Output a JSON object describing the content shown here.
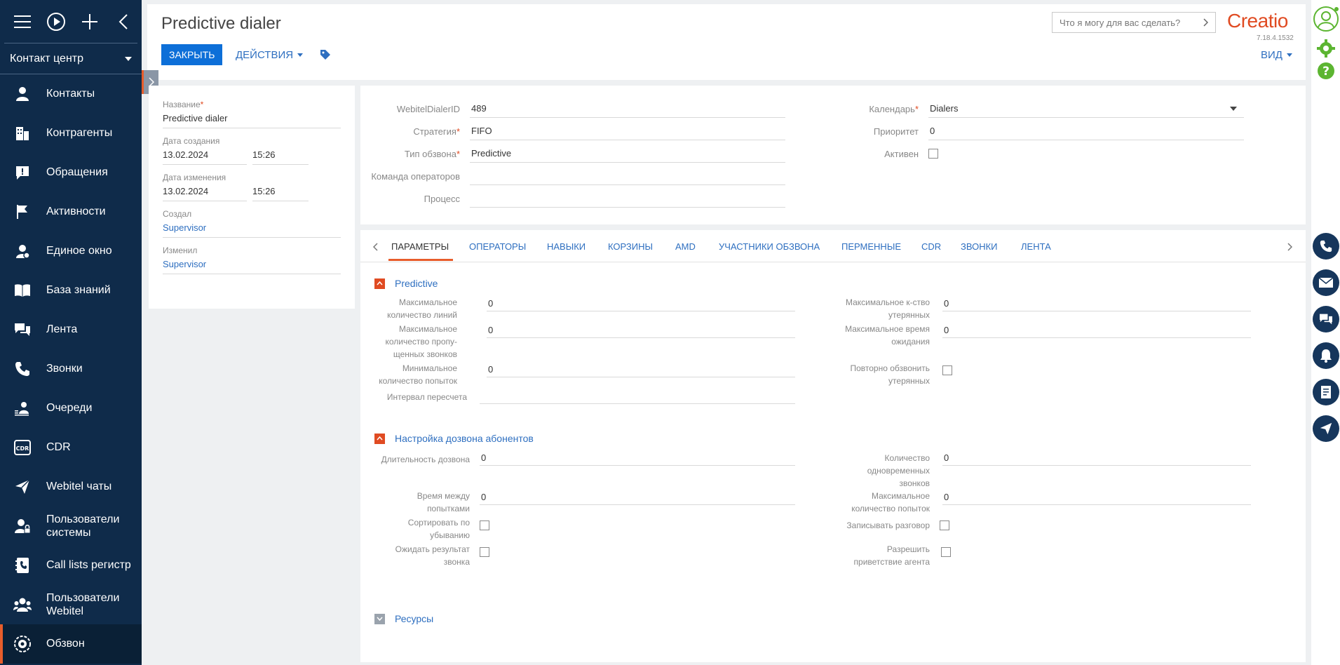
{
  "sidebar": {
    "section": "Контакт центр",
    "items": [
      {
        "label": "Контакты",
        "icon": "person-icon"
      },
      {
        "label": "Контрагенты",
        "icon": "building-icon"
      },
      {
        "label": "Обращения",
        "icon": "alert-icon"
      },
      {
        "label": "Активности",
        "icon": "flag-icon"
      },
      {
        "label": "Единое окно",
        "icon": "person-circle-icon"
      },
      {
        "label": "База знаний",
        "icon": "book-icon"
      },
      {
        "label": "Лента",
        "icon": "chat-icon"
      },
      {
        "label": "Звонки",
        "icon": "phone-icon"
      },
      {
        "label": "Очереди",
        "icon": "queue-icon"
      },
      {
        "label": "CDR",
        "icon": "cdr-icon"
      },
      {
        "label": "Webitel чаты",
        "icon": "send-icon"
      },
      {
        "label": "Пользователи системы",
        "icon": "user-lock-icon"
      },
      {
        "label": "Call lists регистр",
        "icon": "phonebook-icon"
      },
      {
        "label": "Пользователи Webitel",
        "icon": "users-icon"
      },
      {
        "label": "Обзвон",
        "icon": "dialer-icon",
        "active": true
      }
    ]
  },
  "header": {
    "title": "Predictive dialer",
    "close_label": "ЗАКРЫТЬ",
    "actions_label": "ДЕЙСТВИЯ",
    "search_placeholder": "Что я могу для вас сделать?",
    "logo": "Creatio",
    "version": "7.18.4.1532",
    "view_label": "ВИД"
  },
  "info": {
    "name_label": "Название",
    "name_value": "Predictive dialer",
    "created_label": "Дата создания",
    "created_date": "13.02.2024",
    "created_time": "15:26",
    "modified_label": "Дата изменения",
    "modified_date": "13.02.2024",
    "modified_time": "15:26",
    "creator_label": "Создал",
    "creator_value": "Supervisor",
    "modifier_label": "Изменил",
    "modifier_value": "Supervisor"
  },
  "form": {
    "dialer_id_label": "WebitelDialerID",
    "dialer_id_value": "489",
    "strategy_label": "Стратегия",
    "strategy_value": "FIFO",
    "type_label": "Тип обзвона",
    "type_value": "Predictive",
    "team_label": "Команда операторов",
    "team_value": "",
    "process_label": "Процесс",
    "process_value": "",
    "calendar_label": "Календарь",
    "calendar_value": "Dialers",
    "priority_label": "Приоритет",
    "priority_value": "0",
    "active_label": "Активен"
  },
  "tabs": [
    "ПАРАМЕТРЫ",
    "ОПЕРАТОРЫ",
    "НАВЫКИ",
    "КОРЗИНЫ",
    "AMD",
    "УЧАСТНИКИ ОБЗВОНА",
    "ПЕРМЕННЫЕ",
    "CDR",
    "ЗВОНКИ",
    "ЛЕНТА"
  ],
  "predictive": {
    "title": "Predictive",
    "max_lines_label": "Максимальное количество линий",
    "max_lines_value": "0",
    "max_missed_label": "Максимальное количество пропу-щенных звонков",
    "max_missed_value": "0",
    "min_attempts_label": "Минимальное количество попыток",
    "min_attempts_value": "0",
    "recalc_label": "Интервал пересчета",
    "recalc_value": "",
    "max_lost_label": "Максимальное к-ство утерянных",
    "max_lost_value": "0",
    "max_wait_label": "Максимальное время ожидания",
    "max_wait_value": "0",
    "recall_lost_label": "Повторно обзвонить утерянных"
  },
  "dial_settings": {
    "title": "Настройка дозвона абонентов",
    "duration_label": "Длительность дозвона",
    "duration_value": "0",
    "between_label": "Время между попытками",
    "between_value": "0",
    "sort_desc_label": "Сортировать по убыванию",
    "wait_result_label": "Ожидать результат звонка",
    "simultaneous_label": "Количество одновременных звонков",
    "simultaneous_value": "0",
    "max_attempts_label": "Максимальное количество попыток",
    "max_attempts_value": "0",
    "record_label": "Записывать разговор",
    "greeting_label": "Разрешить приветствие агента"
  },
  "resources": {
    "title": "Ресурсы"
  }
}
